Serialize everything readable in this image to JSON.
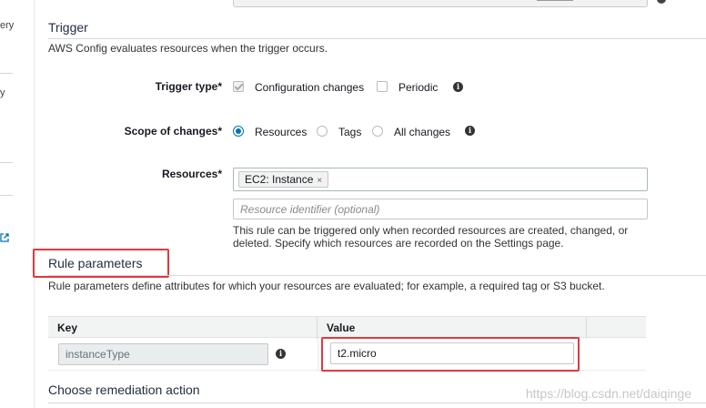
{
  "sidebar": {
    "frag1": "ery",
    "frag2": "y",
    "ext_icon": "external-link-icon"
  },
  "top_info_icon": "info-icon",
  "trigger": {
    "title": "Trigger",
    "description": "AWS Config evaluates resources when the trigger occurs.",
    "trigger_type": {
      "label": "Trigger type*",
      "options": [
        {
          "label": "Configuration changes",
          "checked": true
        },
        {
          "label": "Periodic",
          "checked": false
        }
      ]
    },
    "scope": {
      "label": "Scope of changes*",
      "options": [
        {
          "label": "Resources",
          "selected": true
        },
        {
          "label": "Tags",
          "selected": false
        },
        {
          "label": "All changes",
          "selected": false
        }
      ]
    },
    "resources": {
      "label": "Resources*",
      "token": "EC2: Instance",
      "token_remove": "×",
      "identifier_placeholder": "Resource identifier (optional)",
      "help": "This rule can be triggered only when recorded resources are created, changed, or deleted. Specify which resources are recorded on the Settings page."
    }
  },
  "rule_parameters": {
    "title": "Rule parameters",
    "description": "Rule parameters define attributes for which your resources are evaluated; for example, a required tag or S3 bucket.",
    "columns": {
      "key": "Key",
      "value": "Value"
    },
    "rows": [
      {
        "key": "instanceType",
        "value": "t2.micro"
      }
    ]
  },
  "remediation": {
    "title": "Choose remediation action"
  },
  "watermark": "https://blog.csdn.net/daiqinge",
  "colors": {
    "accent": "#0073bb",
    "highlight": "#e0393e"
  }
}
